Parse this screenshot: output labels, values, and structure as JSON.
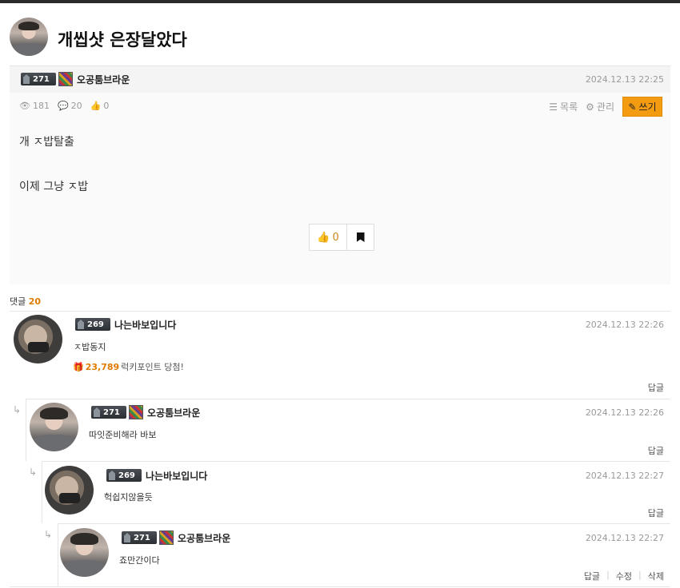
{
  "post": {
    "title": "개씹샷 은장달았다",
    "author": {
      "level": "271",
      "nick": "오공툼브라운"
    },
    "date": "2024.12.13 22:25",
    "views": "181",
    "comments": "20",
    "likes": "0",
    "tools": {
      "list_label": "목록",
      "manage_label": "관리",
      "write_label": "쓰기"
    },
    "body": [
      "개 ㅈ밥탈출",
      "이제 그냥 ㅈ밥"
    ],
    "vote": {
      "like_count": "0"
    }
  },
  "comment_header": {
    "label": "댓글",
    "count": "20"
  },
  "comments": [
    {
      "level": "269",
      "nick": "나는바보입니다",
      "date": "2024.12.13 22:26",
      "text": "ㅈ밥동지",
      "point": {
        "amount": "23,789",
        "suffix": "럭키포인트 당첨!"
      },
      "reply_label": "답글"
    },
    {
      "level": "271",
      "nick": "오공툼브라운",
      "date": "2024.12.13 22:26",
      "text": "따잇준비해라 바보",
      "reply_label": "답글"
    },
    {
      "level": "269",
      "nick": "나는바보입니다",
      "date": "2024.12.13 22:27",
      "text": "헉쉽지않을듯",
      "reply_label": "답글"
    },
    {
      "level": "271",
      "nick": "오공툼브라운",
      "date": "2024.12.13 22:27",
      "text": "죠만간이다",
      "reply_label": "답글",
      "edit_label": "수정",
      "delete_label": "삭제"
    }
  ],
  "colors": {
    "accent": "#f39c12",
    "count_orange": "#e07b00",
    "date_gray": "#9a9a9a"
  },
  "icons": [
    "eye-icon",
    "speech-bubble-icon",
    "thumbs-up-icon",
    "list-icon",
    "gear-icon",
    "pencil-icon",
    "bookmark-icon",
    "gift-icon",
    "reply-arrow-icon"
  ]
}
